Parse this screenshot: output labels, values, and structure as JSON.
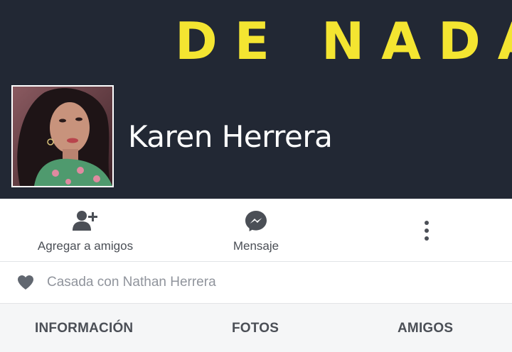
{
  "cover": {
    "text": "DE NADA",
    "background_color": "#222834",
    "text_color": "#f4e531"
  },
  "profile": {
    "name": "Karen Herrera",
    "avatar_icon": "profile-photo"
  },
  "actions": [
    {
      "label": "Agregar a amigos",
      "icon": "add-friend-icon"
    },
    {
      "label": "Mensaje",
      "icon": "messenger-icon"
    },
    {
      "label": "",
      "icon": "more-options-icon"
    }
  ],
  "relationship": {
    "icon": "heart-icon",
    "text": "Casada con Nathan Herrera"
  },
  "tabs": [
    {
      "label": "INFORMACIÓN"
    },
    {
      "label": "FOTOS"
    },
    {
      "label": "AMIGOS"
    }
  ]
}
